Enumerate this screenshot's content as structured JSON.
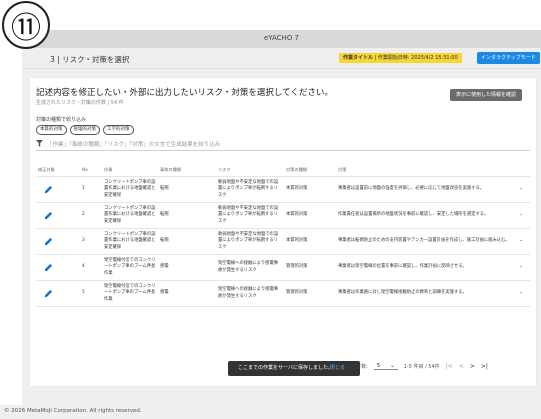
{
  "corner_badge": "⑪",
  "app": {
    "title": "eYACHO 7"
  },
  "header": {
    "step_title": "3 | リスク・対策を選択",
    "work_title": "作業タイトル",
    "work_start": "| 作業開始日時: 2025/4/2 15:31:00",
    "interactive_button": "インタラクティブモード"
  },
  "card": {
    "heading": "記述内容を修正したい・外部に出力したいリスク・対策を選択してください。",
    "subheading": "生成されたリスク・対策の件数 | 54 件",
    "confirm_button": "表示に使用した情報を確認",
    "filter_title": "対策の種類で絞り込み",
    "chips": [
      "本質的対策",
      "管理的対策",
      "工学的対策"
    ],
    "search_placeholder": "「作業」「事故の種類」「リスク」「対策」の文言で生成結果を絞り込み"
  },
  "table": {
    "columns": [
      "修正対象",
      "No.",
      "作業",
      "事故の種類",
      "リスク",
      "対策の種類",
      "対策"
    ],
    "rows": [
      {
        "no": "1",
        "work": "コンクリートポンプ車の設置作業における地盤確認と安定確保",
        "accident": "転倒",
        "risk": "軟弱地盤や不安定な地盤での設置によりポンプ車が転倒するリスク",
        "type": "本質的対策",
        "measure": "事業者は設置前に地盤の強度を評価し、必要に応じて地盤改良を実施する。"
      },
      {
        "no": "2",
        "work": "コンクリートポンプ車の設置作業における地盤確認と安定確保",
        "accident": "転倒",
        "risk": "軟弱地盤や不安定な地盤での設置によりポンプ車が転倒するリスク",
        "type": "本質的対策",
        "measure": "作業責任者は設置場所の地盤状況を事前に確認し、安定した場所を選定する。"
      },
      {
        "no": "3",
        "work": "コンクリートポンプ車の設置作業における地盤確認と安定確保",
        "accident": "転倒",
        "risk": "軟弱地盤や不安定な地盤での設置によりポンプ車が転倒するリスク",
        "type": "本質的対策",
        "measure": "事業者は転倒防止のための支持装置やアンカー設置計画を作成し、施工計画に組み込む。"
      },
      {
        "no": "4",
        "work": "架空電線付近でのコンクリートポンプ車のブーム伸長作業",
        "accident": "感電",
        "risk": "架空電線への接触により感電事故が発生するリスク",
        "type": "管理的対策",
        "measure": "事業者は架空電線の位置を事前に確認し、作業計画に反映させる。"
      },
      {
        "no": "5",
        "work": "架空電線付近でのコンクリートポンプ車のブーム伸長作業",
        "accident": "感電",
        "risk": "架空電線への接触により感電事故が発生するリスク",
        "type": "管理的対策",
        "measure": "事業者は作業員に対し架空電線接触防止の教育と訓練を実施する。"
      }
    ]
  },
  "pager": {
    "per_page_label": "1ページあたりの件数:",
    "per_page_value": "5",
    "range": "1-5 件目 / 54件",
    "first": "|<",
    "prev": "<",
    "next": ">",
    "last": ">|"
  },
  "toast": {
    "message": "ここまでの作業をサーバに保存しました。",
    "close": "閉じる"
  },
  "footer": {
    "copyright": "© 2026 MetaMoJi Corporation. All rights reserved."
  },
  "colors": {
    "accent_blue": "#1e88e5",
    "badge_yellow": "#f7d534",
    "pen_blue": "#1e73d6"
  }
}
